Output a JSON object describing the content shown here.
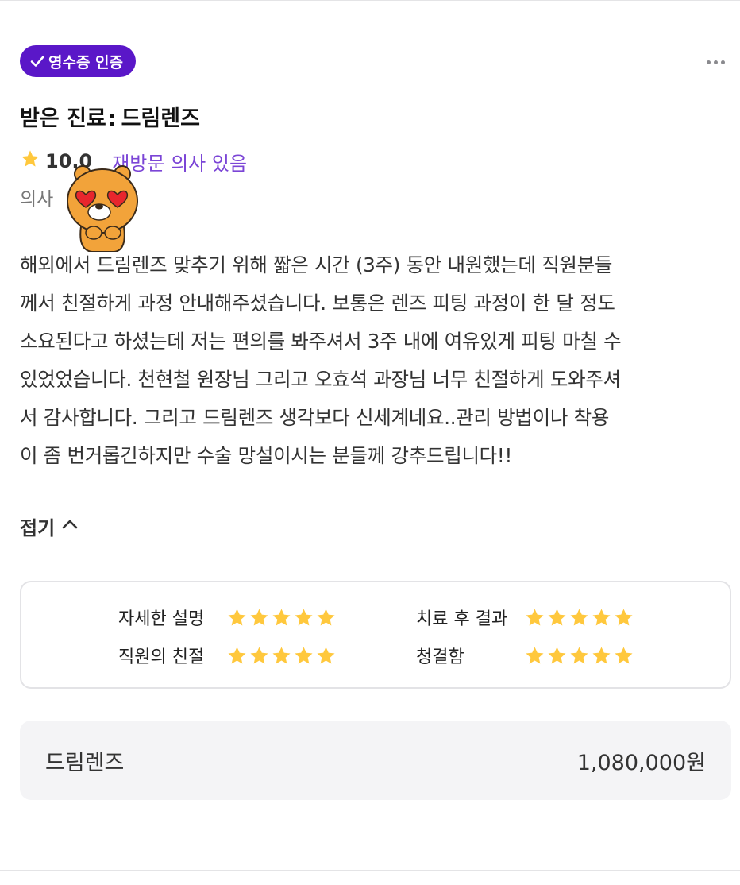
{
  "badge": {
    "label": "영수증 인증",
    "icon": "check-icon",
    "color": "#5a17c8"
  },
  "header": {
    "more_icon": "more-horizontal-icon"
  },
  "title": {
    "prefix": "받은 진료",
    "separator": ":",
    "treatment": "드림렌즈"
  },
  "rating": {
    "score": "10.0",
    "revisit_label": "재방문 의사 있음",
    "star_color": "#ffc83d",
    "revisit_color": "#7b45d6"
  },
  "doctor": {
    "label": "의사"
  },
  "review": {
    "lines": [
      "해외에서 드림렌즈 맞추기 위해 짧은 시간 (3주) 동안 내원했는데 직원분들",
      "께서 친절하게 과정 안내해주셨습니다. 보통은 렌즈 피팅 과정이 한 달 정도",
      "소요된다고 하셨는데 저는 편의를 봐주셔서 3주 내에 여유있게 피팅 마칠 수",
      "있었었습니다. 천현철 원장님 그리고 오효석 과장님 너무 친절하게 도와주셔",
      "서 감사합니다. 그리고 드림렌즈 생각보다 신세계네요..관리 방법이나 착용",
      "이 좀 번거롭긴하지만 수술 망설이시는 분들께 강추드립니다!!"
    ],
    "collapse_label": "접기"
  },
  "scores": {
    "items": [
      {
        "label": "자세한 설명",
        "stars": 5
      },
      {
        "label": "치료 후 결과",
        "stars": 5
      },
      {
        "label": "직원의 친절",
        "stars": 5
      },
      {
        "label": "청결함",
        "stars": 5
      }
    ]
  },
  "price": {
    "item": "드림렌즈",
    "amount": "1,080,000원"
  }
}
